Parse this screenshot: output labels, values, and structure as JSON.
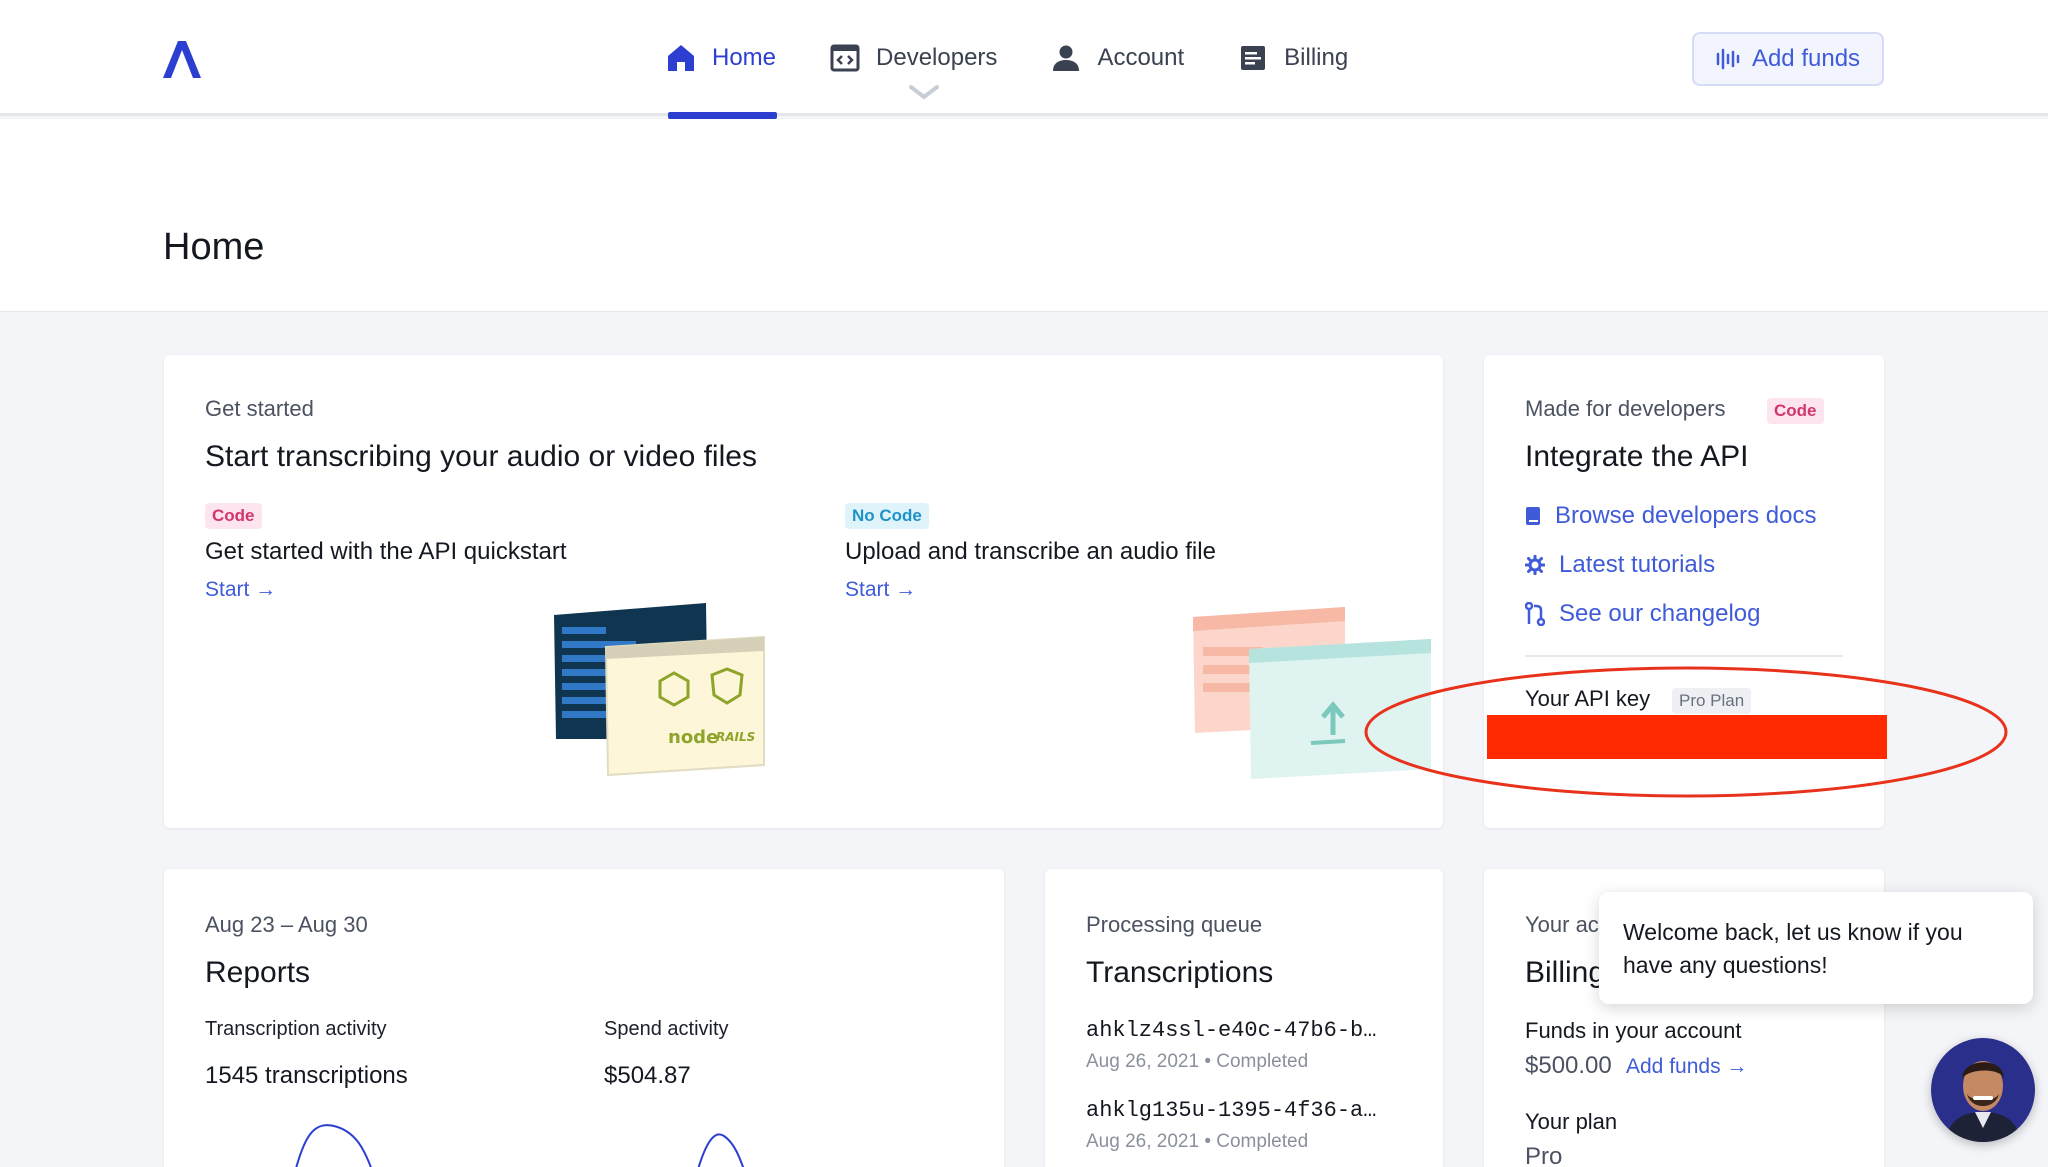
{
  "nav": {
    "items": [
      {
        "label": "Home",
        "icon": "home-icon"
      },
      {
        "label": "Developers",
        "icon": "code-window-icon"
      },
      {
        "label": "Account",
        "icon": "user-icon"
      },
      {
        "label": "Billing",
        "icon": "receipt-icon"
      }
    ],
    "add_funds_label": "Add funds"
  },
  "page": {
    "title": "Home"
  },
  "get_started": {
    "eyebrow": "Get started",
    "title": "Start transcribing your audio or video files",
    "options": [
      {
        "badge": "Code",
        "title": "Get started with the API quickstart",
        "link": "Start →"
      },
      {
        "badge": "No Code",
        "title": "Upload and transcribe an audio file",
        "link": "Start →"
      }
    ],
    "illustration_labels": [
      "node",
      "RAILS"
    ]
  },
  "developers": {
    "eyebrow": "Made for developers",
    "badge": "Code",
    "title": "Integrate the API",
    "links": [
      {
        "label": "Browse developers docs",
        "icon": "book-icon"
      },
      {
        "label": "Latest tutorials",
        "icon": "gear-icon"
      },
      {
        "label": "See our changelog",
        "icon": "changelog-icon"
      }
    ],
    "api_key_label": "Your API key",
    "plan_badge": "Pro Plan"
  },
  "reports": {
    "eyebrow": "Aug 23 – Aug 30",
    "title": "Reports",
    "transcription_label": "Transcription activity",
    "transcription_value": "1545 transcriptions",
    "spend_label": "Spend activity",
    "spend_value": "$504.87"
  },
  "queue": {
    "eyebrow": "Processing queue",
    "title": "Transcriptions",
    "items": [
      {
        "id": "ahklz4ssl-e40c-47b6-b…",
        "date": "Aug 26, 2021",
        "status": "Completed"
      },
      {
        "id": "ahklg135u-1395-4f36-a…",
        "date": "Aug 26, 2021",
        "status": "Completed"
      }
    ],
    "separator": "•"
  },
  "billing": {
    "eyebrow": "Your ac",
    "title": "Billing",
    "funds_label": "Funds in your account",
    "funds_value": "$500.00",
    "add_funds_link": "Add funds →",
    "plan_label": "Your plan",
    "plan_value": "Pro"
  },
  "chat": {
    "message": "Welcome back, let us know if you have any questions!"
  },
  "colors": {
    "brand": "#2c3fd0",
    "link": "#3f5bd8",
    "annotation": "#ff2a00"
  }
}
